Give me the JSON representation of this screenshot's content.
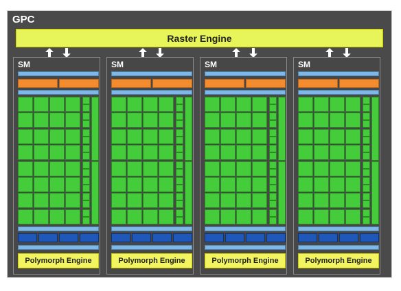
{
  "gpc": {
    "title": "GPC"
  },
  "raster_engine": {
    "label": "Raster Engine"
  },
  "sm_units": [
    {
      "label": "SM",
      "engine": "Polymorph Engine"
    },
    {
      "label": "SM",
      "engine": "Polymorph Engine"
    },
    {
      "label": "SM",
      "engine": "Polymorph Engine"
    },
    {
      "label": "SM",
      "engine": "Polymorph Engine"
    }
  ],
  "colors": {
    "background": "#4a4a4a",
    "raster_engine": "#e8f55a",
    "cache_bar": "#7fb8e6",
    "warp_scheduler": "#f28c2e",
    "core": "#45cc3a",
    "load_store": "#1f58b8",
    "polymorph_engine": "#f3f560"
  }
}
